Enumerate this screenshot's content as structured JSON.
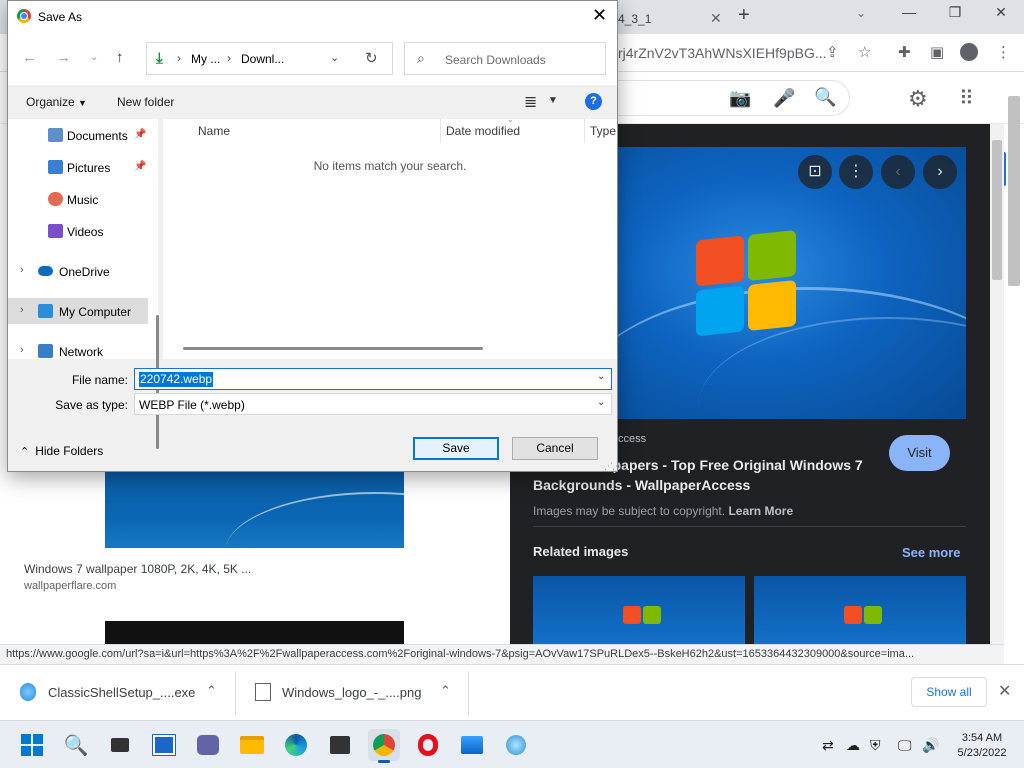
{
  "browser": {
    "tab_partial_title": "4_3_1",
    "url_fragment": "rj4rZnV2vT3AhWNsXIEHf9pBG...",
    "status_url": "https://www.google.com/url?sa=i&url=https%3A%2F%2Fwallpaperaccess.com%2Foriginal-windows-7&psig=AOvVaw17SPuRLDex5--BskeH62h2&ust=1653364432309000&source=ima..."
  },
  "results": {
    "item_title": "Windows 7 wallpaper 1080P, 2K, 4K, 5K ...",
    "item_site": "wallpaperflare.com"
  },
  "preview": {
    "source": "ccess",
    "title": "dows 7 Wallpapers - Top Free Original Windows 7 Backgrounds - WallpaperAccess",
    "visit_label": "Visit",
    "copyright_text": "Images may be subject to copyright.",
    "learn_more": "Learn More",
    "related_label": "Related images",
    "see_more": "See more"
  },
  "dialog": {
    "title": "Save As",
    "address": {
      "crumb1": "My ...",
      "crumb2": "Downl..."
    },
    "search_placeholder": "Search Downloads",
    "organize": "Organize",
    "new_folder": "New folder",
    "help": "?",
    "nav": [
      {
        "label": "Documents",
        "icon": "documents-folder-icon",
        "color": "#5f8fc7"
      },
      {
        "label": "Pictures",
        "icon": "pictures-folder-icon",
        "color": "#3b7fd4"
      },
      {
        "label": "Music",
        "icon": "music-folder-icon",
        "color": "#e26a55"
      },
      {
        "label": "Videos",
        "icon": "videos-folder-icon",
        "color": "#7a4fc9"
      },
      {
        "label": "OneDrive",
        "icon": "onedrive-icon",
        "color": "#0f6cbd"
      },
      {
        "label": "My Computer",
        "icon": "computer-icon",
        "color": "#2e8bd8"
      },
      {
        "label": "Network",
        "icon": "network-icon",
        "color": "#3a7fc4"
      }
    ],
    "columns": {
      "name": "Name",
      "date": "Date modified",
      "type": "Type"
    },
    "empty_message": "No items match your search.",
    "file_name_label": "File name:",
    "file_name_value": "220742.webp",
    "save_type_label": "Save as type:",
    "save_type_value": "WEBP File (*.webp)",
    "hide_folders": "Hide Folders",
    "save": "Save",
    "cancel": "Cancel"
  },
  "downloads": {
    "item1": "ClassicShellSetup_....exe",
    "item2": "Windows_logo_-_....png",
    "show_all": "Show all"
  },
  "taskbar": {
    "time": "3:54 AM",
    "date": "5/23/2022"
  },
  "colors": {
    "accent": "#1a73e8",
    "win_blue": "#0078d7",
    "preview_bg": "#202124"
  }
}
